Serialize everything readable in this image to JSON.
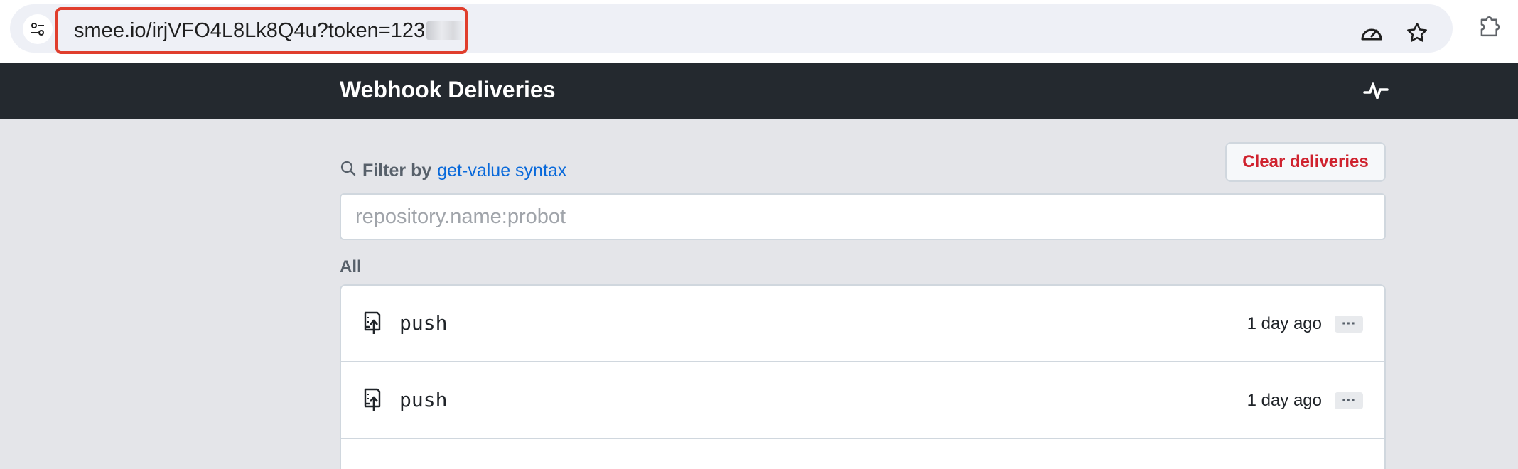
{
  "browser": {
    "url_visible": "smee.io/irjVFO4L8Lk8Q4u?token=123",
    "icons": [
      "tune-icon",
      "performance-gauge-icon",
      "bookmark-star-icon",
      "extensions-puzzle-icon"
    ]
  },
  "header": {
    "title": "Webhook Deliveries",
    "status_icon": "pulse-icon"
  },
  "filter": {
    "label": "Filter by",
    "link_text": "get-value syntax",
    "placeholder": "repository.name:probot",
    "value": ""
  },
  "actions": {
    "clear_label": "Clear deliveries"
  },
  "list": {
    "section_label": "All",
    "items": [
      {
        "event": "push",
        "time": "1 day ago",
        "more": "···",
        "icon": "repo-push-icon"
      },
      {
        "event": "push",
        "time": "1 day ago",
        "more": "···",
        "icon": "repo-push-icon"
      }
    ]
  },
  "colors": {
    "header_bg": "#24292f",
    "page_bg": "#e4e5e9",
    "link": "#0969da",
    "danger": "#cf222e",
    "url_highlight": "#e03e2d"
  }
}
